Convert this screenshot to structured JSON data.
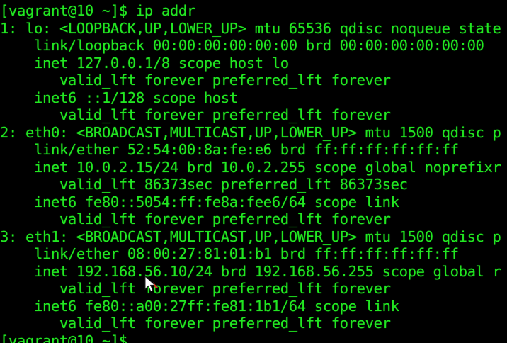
{
  "terminal": {
    "colors": {
      "background": "#000000",
      "text": "#22e622",
      "cursor_arrow": "#ffffff",
      "cursor_accent": "#e03020"
    },
    "lines": [
      "[vagrant@10 ~]$ ip addr",
      "1: lo: <LOOPBACK,UP,LOWER_UP> mtu 65536 qdisc noqueue state",
      "    link/loopback 00:00:00:00:00:00 brd 00:00:00:00:00:00",
      "    inet 127.0.0.1/8 scope host lo",
      "       valid_lft forever preferred_lft forever",
      "    inet6 ::1/128 scope host",
      "       valid_lft forever preferred_lft forever",
      "2: eth0: <BROADCAST,MULTICAST,UP,LOWER_UP> mtu 1500 qdisc p",
      "    link/ether 52:54:00:8a:fe:e6 brd ff:ff:ff:ff:ff:ff",
      "    inet 10.0.2.15/24 brd 10.0.2.255 scope global noprefixr",
      "       valid_lft 86373sec preferred_lft 86373sec",
      "    inet6 fe80::5054:ff:fe8a:fee6/64 scope link",
      "       valid_lft forever preferred_lft forever",
      "3: eth1: <BROADCAST,MULTICAST,UP,LOWER_UP> mtu 1500 qdisc p",
      "    link/ether 08:00:27:81:01:b1 brd ff:ff:ff:ff:ff:ff",
      "    inet 192.168.56.10/24 brd 192.168.56.255 scope global r",
      "       valid_lft forever preferred_lft forever",
      "    inet6 fe80::a00:27ff:fe81:1b1/64 scope link",
      "       valid_lft forever preferred_lft forever",
      "[vagrant@10 ~]$"
    ],
    "cursor_icon": "mouse-pointer-icon"
  }
}
